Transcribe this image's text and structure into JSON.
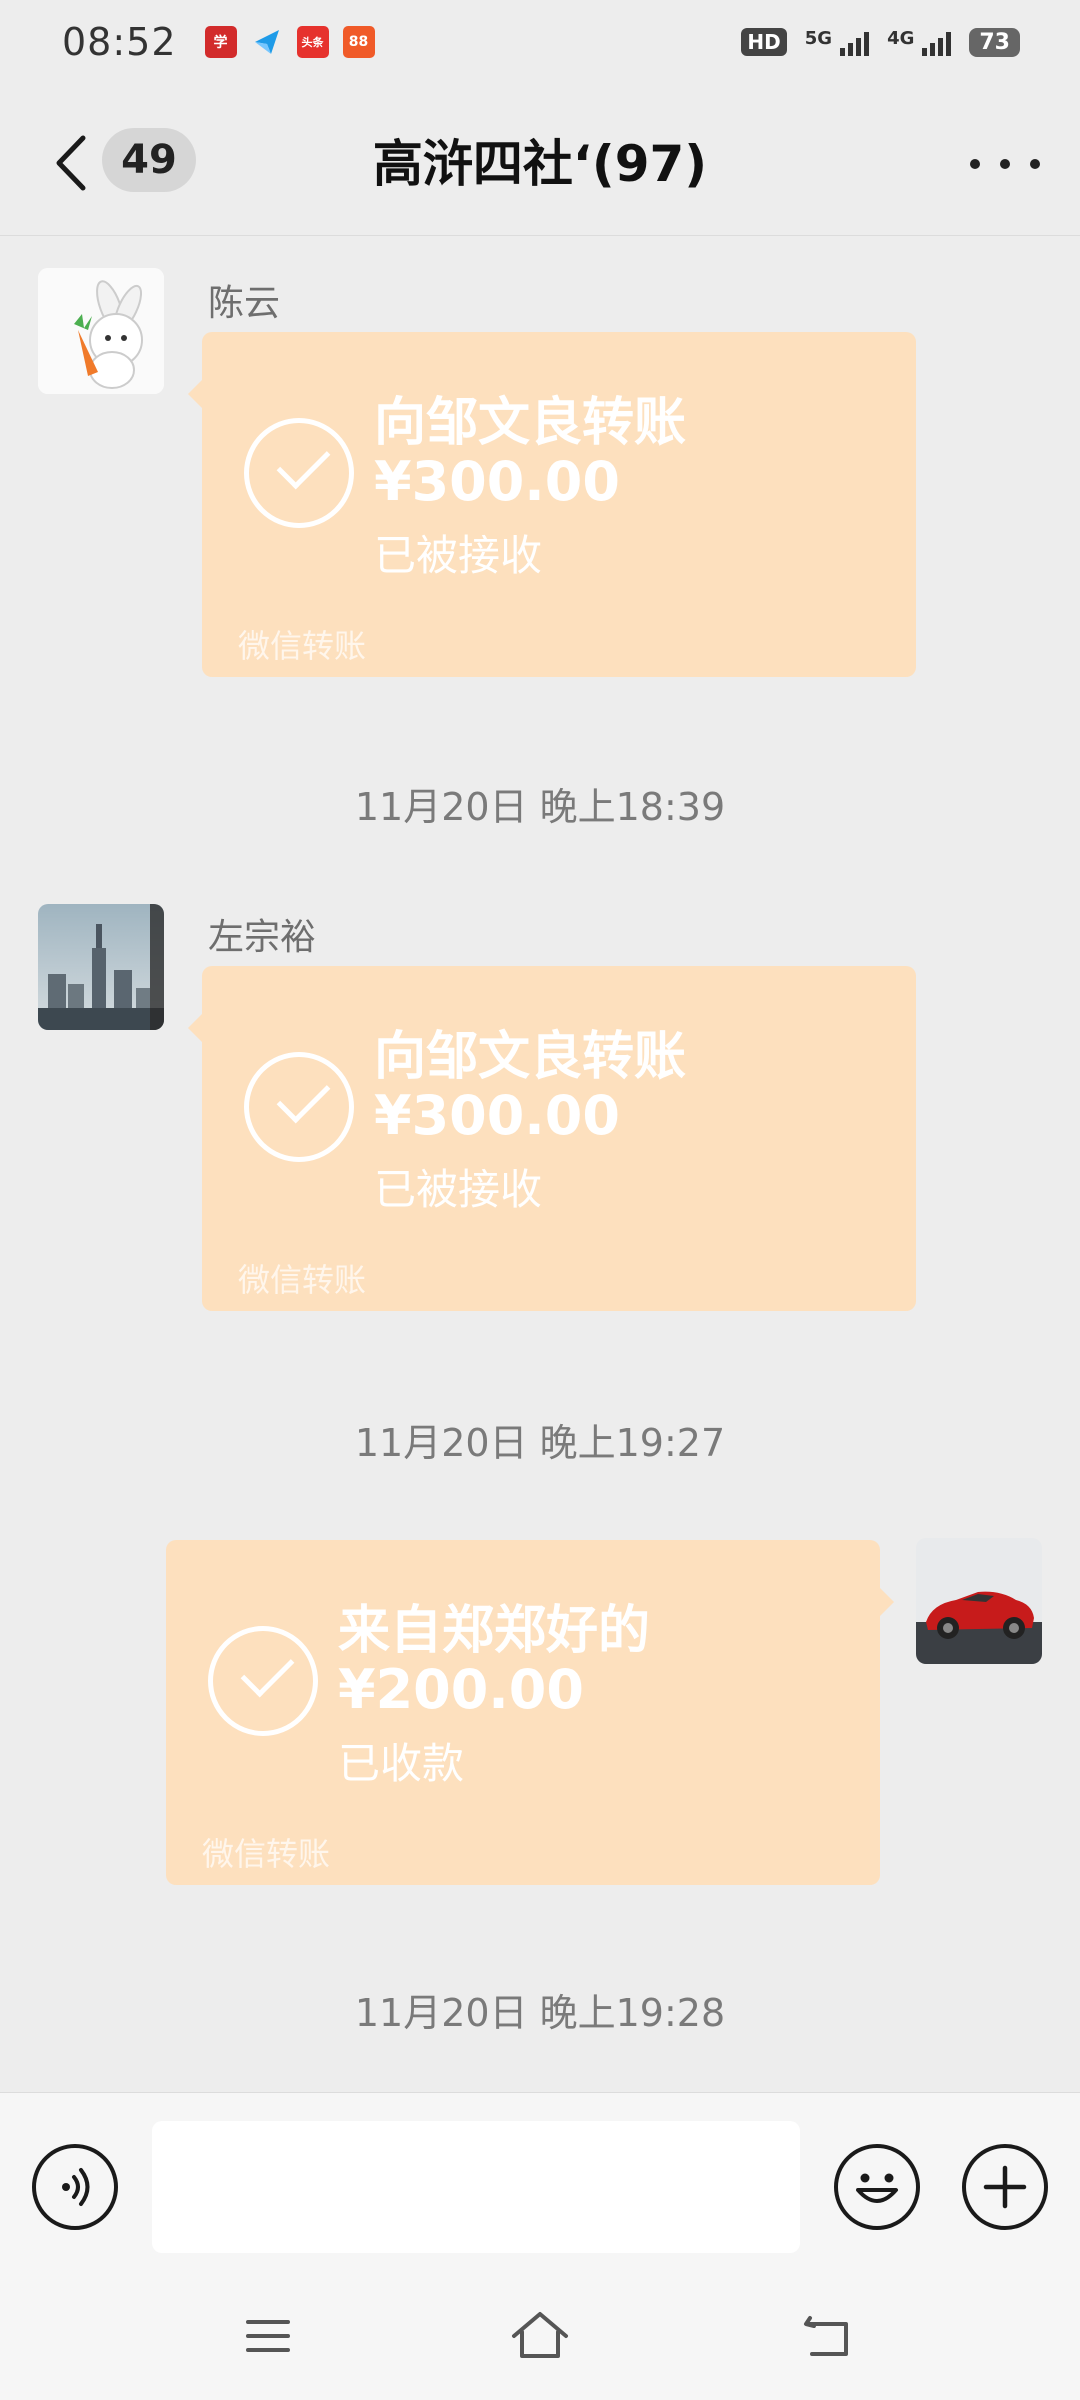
{
  "status_bar": {
    "time": "08:52",
    "notification_icons": [
      "app-notification-red",
      "app-notification-blue",
      "app-notification-toutiao",
      "app-notification-orange"
    ],
    "notif_labels": [
      "学",
      "",
      "头条",
      "88"
    ],
    "hd_label": "HD",
    "network_5g": "5G",
    "network_4g": "4G",
    "battery": "73"
  },
  "header": {
    "unread_count": "49",
    "title": "高浒四社‘(97)"
  },
  "messages": [
    {
      "sender": "陈云",
      "side": "left",
      "title": "向邹文良转账",
      "amount": "¥300.00",
      "status": "已被接收",
      "footer": "微信转账"
    },
    {
      "sender": "左宗裕",
      "side": "left",
      "title": "向邹文良转账",
      "amount": "¥300.00",
      "status": "已被接收",
      "footer": "微信转账"
    },
    {
      "sender": "",
      "side": "right",
      "title": "来自郑郑好的",
      "amount": "¥200.00",
      "status": "已收款",
      "footer": "微信转账"
    }
  ],
  "timestamps": [
    "11月20日 晚上18:39",
    "11月20日 晚上19:27",
    "11月20日 晚上19:28"
  ],
  "colors": {
    "transfer_bubble": "#fde0be",
    "background": "#ededed"
  },
  "input_bar": {
    "left_icon": "voice-icon",
    "right_icons": [
      "emoji-icon",
      "plus-icon"
    ]
  },
  "nav_bar": {
    "icons": [
      "menu-icon",
      "home-icon",
      "back-icon"
    ]
  }
}
